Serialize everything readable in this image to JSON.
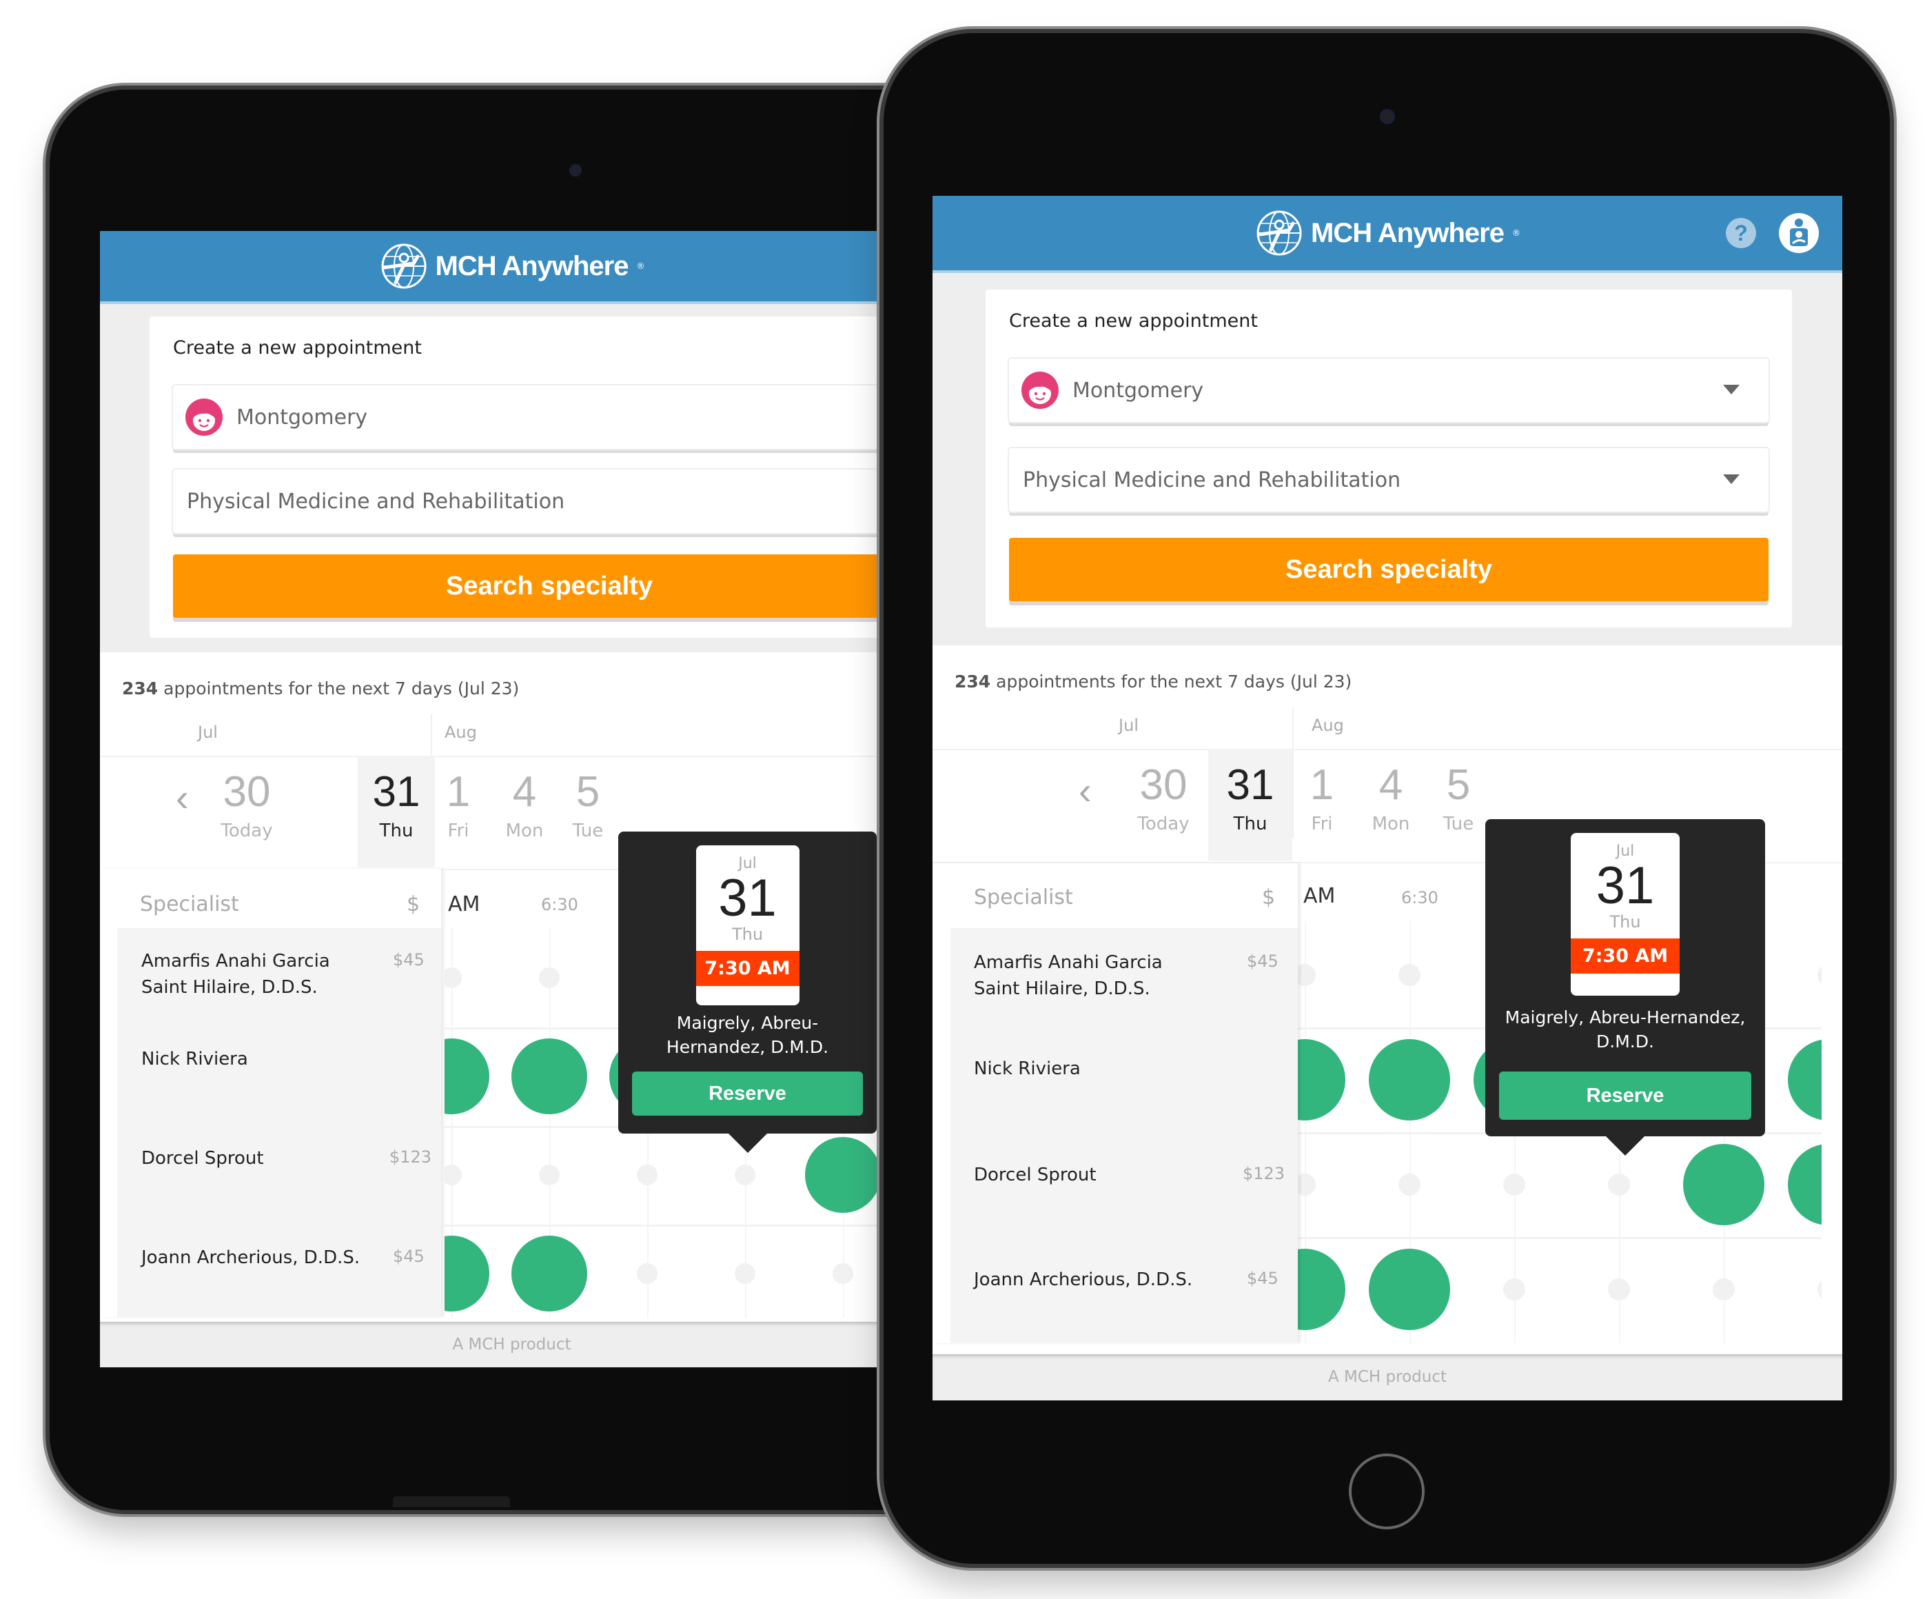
{
  "app": {
    "brand_name": "MCH Anywhere",
    "brand_mark": "®",
    "help_icon": "help-icon",
    "profile_icon": "parent-child-profile-icon"
  },
  "form": {
    "title": "Create a new appointment",
    "patient": {
      "value": "Montgomery",
      "avatar_icon": "girl-face-icon",
      "avatar_color": "#e53d78"
    },
    "specialty": {
      "value": "Physical Medicine and Rehabilitation"
    },
    "search_button": "Search specialty"
  },
  "results": {
    "count": "234",
    "count_suffix": " appointments for the next 7 days (Jul 23)",
    "months": [
      "Jul",
      "Aug"
    ],
    "prev_icon": "chevron-left-icon",
    "days": [
      {
        "num": "30",
        "label": "Today",
        "selected": false
      },
      {
        "num": "31",
        "label": "Thu",
        "selected": true
      },
      {
        "num": "1",
        "label": "Fri",
        "selected": false
      },
      {
        "num": "4",
        "label": "Mon",
        "selected": false
      },
      {
        "num": "5",
        "label": "Tue",
        "selected": false
      }
    ],
    "specialist_header": "Specialist",
    "price_header": "$",
    "time_labels": [
      "AM",
      "6:30"
    ],
    "specialists": [
      {
        "name_line1": "Amarfis Anahi Garcia",
        "name_line2": "Saint Hilaire, D.D.S.",
        "price": "$45",
        "slots": [
          0,
          0,
          0,
          0,
          0,
          0
        ]
      },
      {
        "name_line1": "Nick Riviera",
        "name_line2": "",
        "price": "",
        "slots": [
          1,
          1,
          1,
          2,
          1,
          1
        ]
      },
      {
        "name_line1": "Dorcel Sprout",
        "name_line2": "",
        "price": "$123",
        "slots": [
          0,
          0,
          0,
          0,
          1,
          1
        ]
      },
      {
        "name_line1": "Joann Archerious, D.D.S.",
        "name_line2": "",
        "price": "$45",
        "slots": [
          1,
          1,
          0,
          0,
          0,
          0
        ]
      }
    ]
  },
  "popover": {
    "month": "Jul",
    "day": "31",
    "dow": "Thu",
    "time": "7:30 AM",
    "doctor": "Maigrely, Abreu-Hernandez, D.M.D.",
    "reserve_button": "Reserve"
  },
  "footer": {
    "text": "A MCH product"
  },
  "colors": {
    "header": "#3a8bbf",
    "search_button": "#ff9500",
    "slot_available": "#33b57e",
    "time_badge": "#ff3d00",
    "popover_bg": "#262626"
  }
}
